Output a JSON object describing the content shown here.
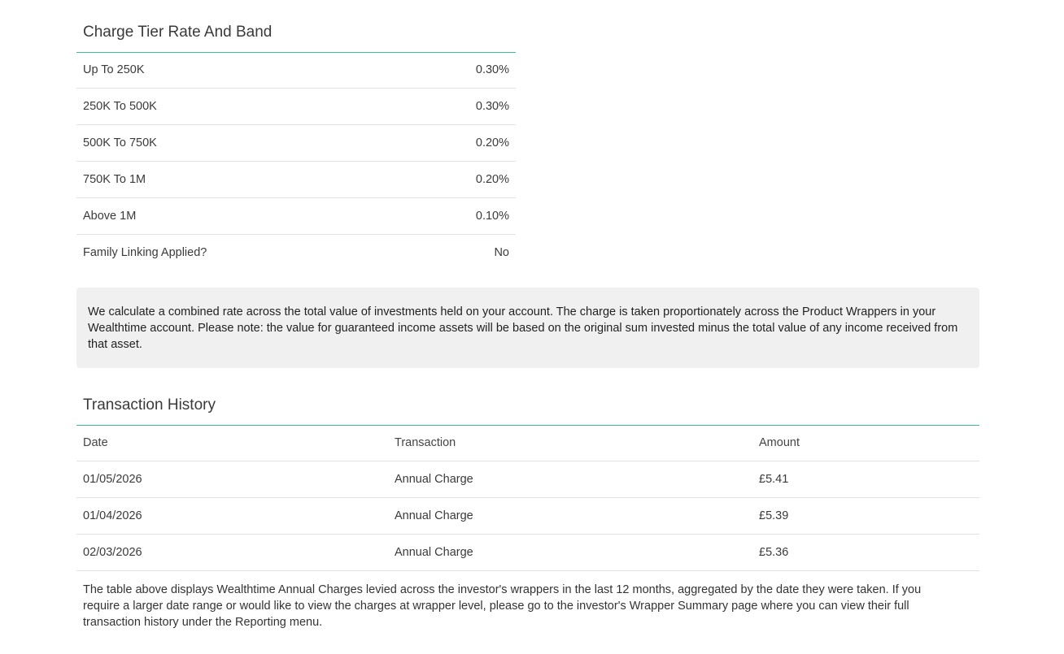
{
  "charge_tiers": {
    "title": "Charge Tier Rate And Band",
    "rows": [
      {
        "label": "Up To 250K",
        "value": "0.30%"
      },
      {
        "label": "250K To 500K",
        "value": "0.30%"
      },
      {
        "label": "500K To 750K",
        "value": "0.20%"
      },
      {
        "label": "750K To 1M",
        "value": "0.20%"
      },
      {
        "label": "Above 1M",
        "value": "0.10%"
      },
      {
        "label": "Family Linking Applied?",
        "value": "No"
      }
    ]
  },
  "info_note": "We calculate a combined rate across the total value of investments held on your account. The charge is taken proportionately across the Product Wrappers in your Wealthtime account. Please note: the value for guaranteed income assets will be based on the original sum invested minus the total value of any income received from that asset.",
  "transaction_history": {
    "title": "Transaction History",
    "columns": {
      "date": "Date",
      "transaction": "Transaction",
      "amount": "Amount"
    },
    "rows": [
      {
        "date": "01/05/2026",
        "transaction": "Annual Charge",
        "amount": "£5.41"
      },
      {
        "date": "01/04/2026",
        "transaction": "Annual Charge",
        "amount": "£5.39"
      },
      {
        "date": "02/03/2026",
        "transaction": "Annual Charge",
        "amount": "£5.36"
      }
    ],
    "footnote": "The table above displays Wealthtime Annual Charges levied across the investor's wrappers in the last 12 months, aggregated by the date they were taken. If you require a larger date range or would like to view the charges at wrapper level, please go to the investor's Wrapper Summary page where you can view their full transaction history under the Reporting menu."
  },
  "colors": {
    "accent_rule": "#3dbb94",
    "info_box_bg": "#f0f0f0",
    "row_divider": "#e2e2e2"
  }
}
